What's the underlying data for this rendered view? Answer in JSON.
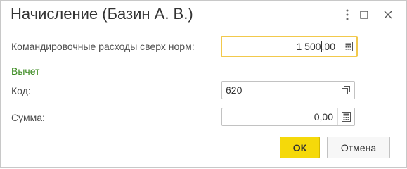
{
  "window": {
    "title": "Начисление (Базин А. В.)",
    "more_icon": "more-vertical-icon",
    "maximize_icon": "maximize-icon",
    "close_icon": "close-icon"
  },
  "form": {
    "travel_expenses": {
      "label": "Командировочные расходы сверх норм:",
      "value_int": "1 500",
      "value_frac": ",00",
      "icon": "calculator-icon"
    },
    "deduction_section": "Вычет",
    "code": {
      "label": "Код:",
      "value": "620",
      "icon": "open-link-icon"
    },
    "amount": {
      "label": "Сумма:",
      "value": "0,00",
      "icon": "calculator-icon"
    }
  },
  "buttons": {
    "ok": "ОК",
    "cancel": "Отмена"
  },
  "colors": {
    "accent_yellow": "#f5d90a",
    "focus_border": "#f2c94c",
    "section_green": "#3a8a1f"
  }
}
